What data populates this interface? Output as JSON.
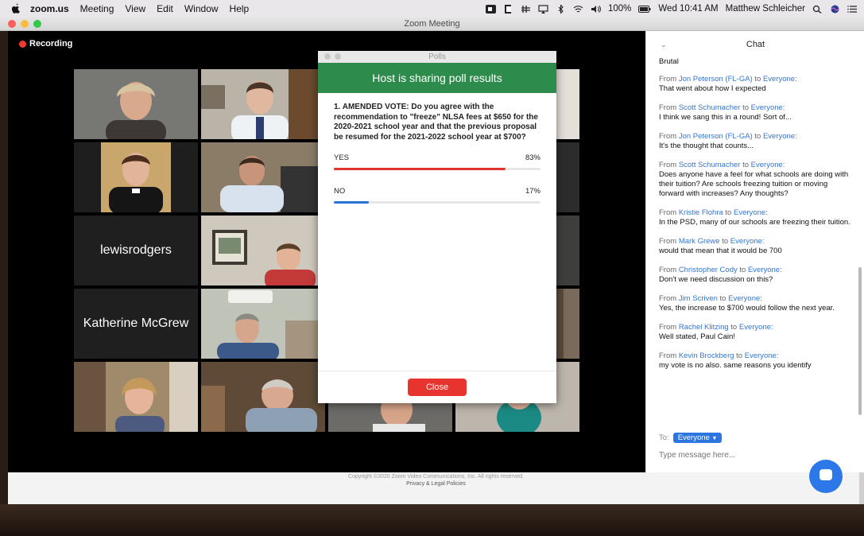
{
  "menubar": {
    "app": "zoom.us",
    "items": [
      "Meeting",
      "View",
      "Edit",
      "Window",
      "Help"
    ],
    "battery": "100%",
    "clock": "Wed 10:41 AM",
    "user": "Matthew Schleicher"
  },
  "window": {
    "title": "Zoom Meeting"
  },
  "meeting": {
    "recording_label": "Recording",
    "name_tiles": [
      "lewisrodgers",
      "Katherine McGrew"
    ]
  },
  "poll": {
    "window_title": "Polls",
    "banner": "Host is sharing poll results",
    "question": "1. AMENDED VOTE: Do you agree with the recommendation to \"freeze\" NLSA fees at $650 for the 2020-2021 school year and that the previous proposal be resumed for the 2021-2022 school year at $700?",
    "options": [
      {
        "label": "YES",
        "percent_label": "83%",
        "percent": 83,
        "color": "#e0332c"
      },
      {
        "label": "NO",
        "percent_label": "17%",
        "percent": 17,
        "color": "#2a73d6"
      }
    ],
    "close_label": "Close"
  },
  "chat": {
    "title": "Chat",
    "first_line_partial": "Brutal",
    "from_prefix": "From",
    "to_word": "to",
    "to_everyone": "Everyone:",
    "messages": [
      {
        "sender": "Jon Peterson (FL-GA)",
        "text": "That went about how I expected"
      },
      {
        "sender": "Scott Schumacher",
        "text": "I think we sang this in a round! Sort of..."
      },
      {
        "sender": "Jon Peterson (FL-GA)",
        "text": "It's the thought that counts..."
      },
      {
        "sender": "Scott Schumacher",
        "text": "Does anyone have a feel for what schools are doing with their tuition?  Are schools freezing tuition or moving forward with increases?  Any thoughts?"
      },
      {
        "sender": "Kristie Flohra",
        "text": "In the PSD, many of our schools are freezing their tuition."
      },
      {
        "sender": "Mark Grewe",
        "text": "would that mean that it would be 700"
      },
      {
        "sender": "Christopher Cody",
        "text": "Don't we need discussion on this?"
      },
      {
        "sender": "Jim Scriven",
        "text": "Yes, the increase to $700 would follow the next year."
      },
      {
        "sender": "Rachel Klitzing",
        "text": "Well stated, Paul Cain!"
      },
      {
        "sender": "Kevin Brockberg",
        "text": "my vote is no also.  same reasons you identify"
      }
    ],
    "to_label": "To:",
    "recipient": "Everyone",
    "input_placeholder": "Type message here..."
  },
  "page": {
    "copyright": "Copyright ©2020 Zoom Video Communications, Inc. All rights reserved.",
    "privacy": "Privacy & Legal Policies"
  }
}
